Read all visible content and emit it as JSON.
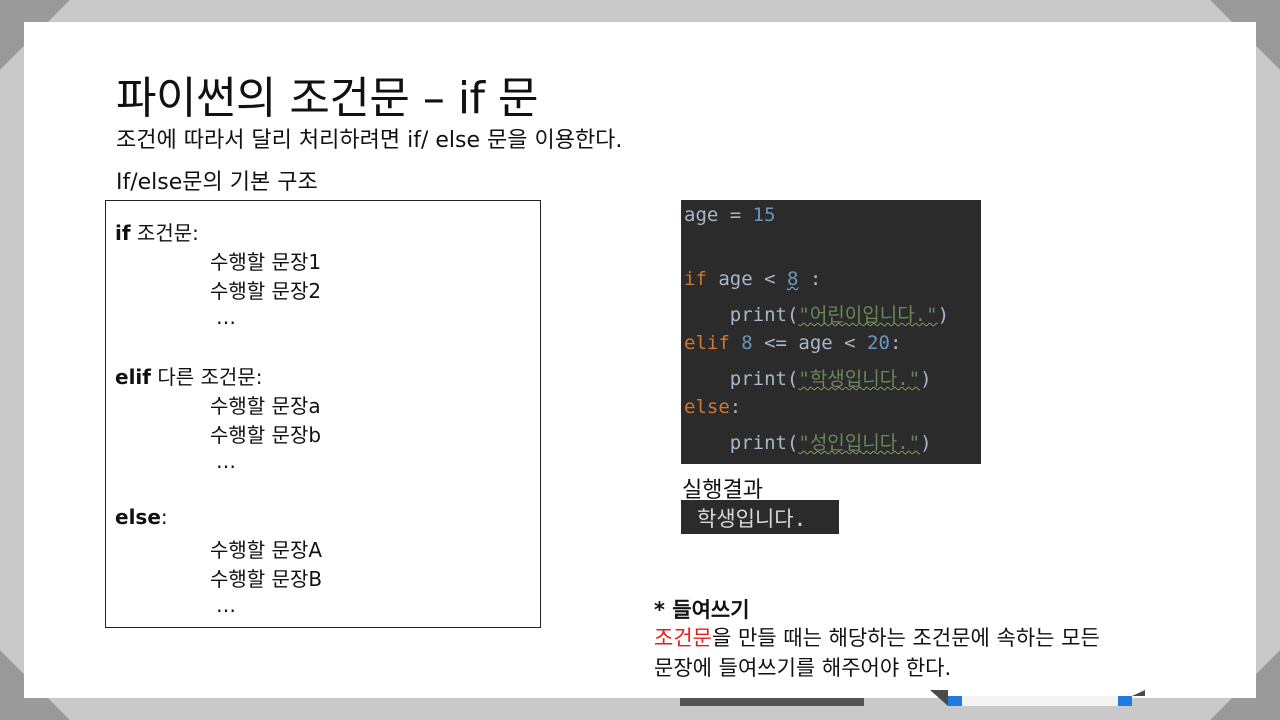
{
  "slide": {
    "title": "파이썬의 조건문 – if 문",
    "subtitle": "조건에 따라서 달리 처리하려면 if/ else 문을 이용한다.",
    "structure_heading": "If/else문의 기본 구조"
  },
  "structure": {
    "if_kw": "if",
    "if_rest": " 조건문:",
    "if_lines": [
      "수행할 문장1",
      "수행할 문장2",
      "…"
    ],
    "elif_kw": "elif",
    "elif_rest": " 다른 조건문:",
    "elif_lines": [
      "수행할 문장a",
      "수행할 문장b",
      "…"
    ],
    "else_kw": "else",
    "else_rest": ":",
    "else_lines": [
      "수행할 문장A",
      "수행할 문장B",
      "…"
    ]
  },
  "code": {
    "line1": {
      "var": "age",
      "op": " = ",
      "num": "15"
    },
    "line2": {
      "kw": "if",
      "mid": " age < ",
      "num": "8",
      "end": " :"
    },
    "line3": {
      "fn": "    print(",
      "str": "\"어린이입니다.\"",
      "end": ")"
    },
    "line4": {
      "kw": "elif",
      "n1": " 8",
      "mid": " <= age < ",
      "n2": "20",
      "end": ":"
    },
    "line5": {
      "fn": "    print(",
      "str": "\"학생입니다.\"",
      "end": ")"
    },
    "line6": {
      "kw": "else",
      "end": ":"
    },
    "line7": {
      "fn": "    print(",
      "str": "\"성인입니다.\"",
      "end": ")"
    }
  },
  "result": {
    "label": "실행결과",
    "output": "학생입니다."
  },
  "note": {
    "title": "* 들여쓰기",
    "highlight": "조건문",
    "line1_rest": "을 만들 때는 해당하는 조건문에 속하는 모든",
    "line2": "문장에 들여쓰기를 해주어야 한다."
  },
  "colors": {
    "background_frame": "#c9c9c9",
    "code_background": "#2b2b2b",
    "keyword": "#cc7832",
    "number": "#6897bb",
    "string": "#6a8759",
    "highlight_red": "#e02020"
  }
}
